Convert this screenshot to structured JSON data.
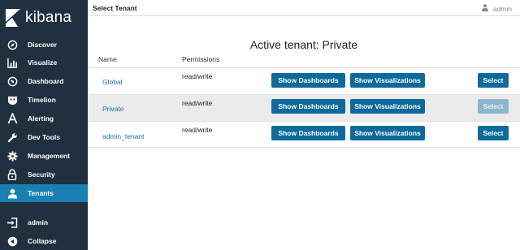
{
  "app": {
    "name": "kibana"
  },
  "sidebar": {
    "items": [
      {
        "label": "Discover",
        "icon": "compass-icon"
      },
      {
        "label": "Visualize",
        "icon": "bar-chart-icon"
      },
      {
        "label": "Dashboard",
        "icon": "dashboard-icon"
      },
      {
        "label": "Timelion",
        "icon": "shield-face-icon"
      },
      {
        "label": "Alerting",
        "icon": "alerting-a-icon"
      },
      {
        "label": "Dev Tools",
        "icon": "wrench-icon"
      },
      {
        "label": "Management",
        "icon": "gear-icon"
      },
      {
        "label": "Security",
        "icon": "lock-icon"
      },
      {
        "label": "Tenants",
        "icon": "users-icon",
        "active": true
      }
    ],
    "bottom_items": [
      {
        "label": "admin",
        "icon": "logout-icon"
      },
      {
        "label": "Collapse",
        "icon": "collapse-icon"
      }
    ]
  },
  "header": {
    "title": "Select Tenant",
    "user": "admin"
  },
  "main": {
    "active_tenant_title": "Active tenant: Private",
    "columns": {
      "name": "Name",
      "permissions": "Permissions"
    },
    "tenants": [
      {
        "name": "Global",
        "permissions": "read/write",
        "show_dashboards": "Show Dashboards",
        "show_visualizations": "Show Visualizations",
        "select": "Select",
        "selected": false
      },
      {
        "name": "Private",
        "permissions": "read/write",
        "show_dashboards": "Show Dashboards",
        "show_visualizations": "Show Visualizations",
        "select": "Select",
        "selected": true
      },
      {
        "name": "admin_tenant",
        "permissions": "read/write",
        "show_dashboards": "Show Dashboards",
        "show_visualizations": "Show Visualizations",
        "select": "Select",
        "selected": false
      }
    ]
  },
  "colors": {
    "sidebar_bg": "#20303f",
    "active_nav": "#1a7fb3",
    "button": "#0e6a9c",
    "button_disabled": "#8cb6cc",
    "link": "#1d6fa5",
    "selected_row": "#ebebeb"
  }
}
